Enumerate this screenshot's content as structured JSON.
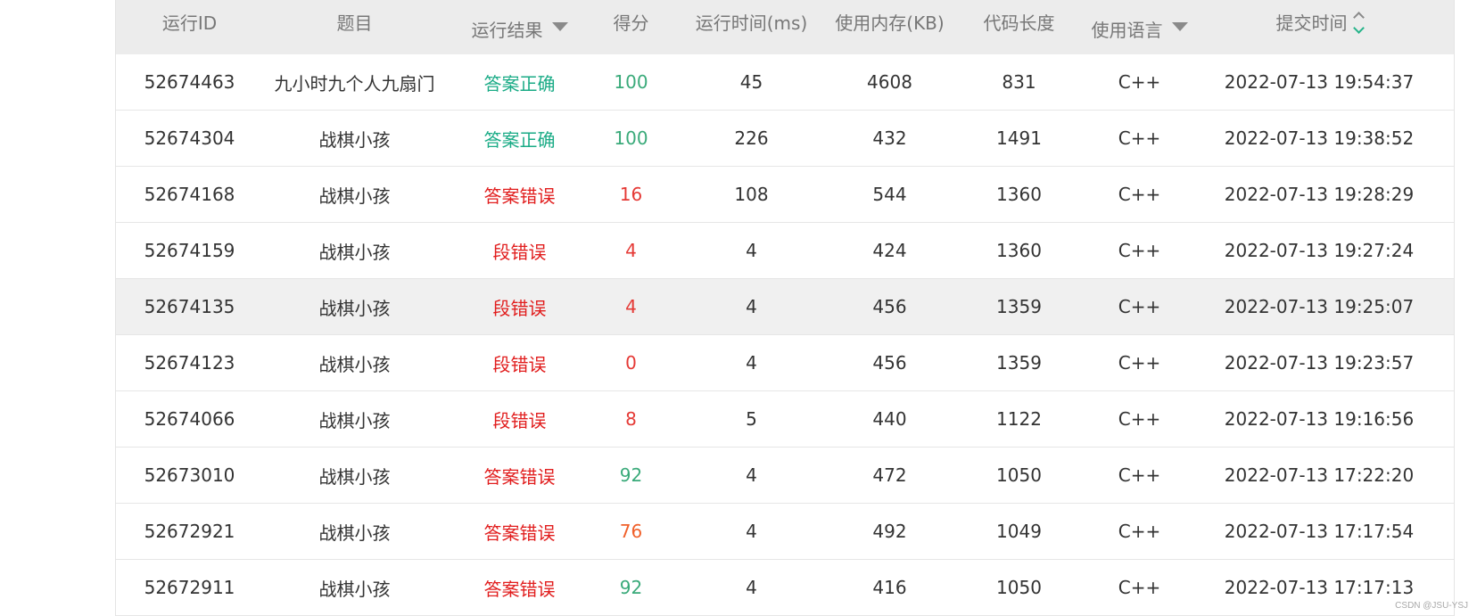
{
  "columns": {
    "run_id": "运行ID",
    "title": "题目",
    "result": "运行结果",
    "score": "得分",
    "time": "运行时间(ms)",
    "memory": "使用内存(KB)",
    "code_length": "代码长度",
    "language": "使用语言",
    "submit_time": "提交时间"
  },
  "colors": {
    "accepted": "#1aab86",
    "error": "#e11d1d",
    "score_green": "#3aaa7a",
    "score_red": "#e53935",
    "score_orange": "#f0602a"
  },
  "rows": [
    {
      "run_id": "52674463",
      "title": "九小时九个人九扇门",
      "result": "答案正确",
      "score": "100",
      "time": "45",
      "memory": "4608",
      "code_length": "831",
      "language": "C++",
      "submit_time": "2022-07-13 19:54:37"
    },
    {
      "run_id": "52674304",
      "title": "战棋小孩",
      "result": "答案正确",
      "score": "100",
      "time": "226",
      "memory": "432",
      "code_length": "1491",
      "language": "C++",
      "submit_time": "2022-07-13 19:38:52"
    },
    {
      "run_id": "52674168",
      "title": "战棋小孩",
      "result": "答案错误",
      "score": "16",
      "time": "108",
      "memory": "544",
      "code_length": "1360",
      "language": "C++",
      "submit_time": "2022-07-13 19:28:29"
    },
    {
      "run_id": "52674159",
      "title": "战棋小孩",
      "result": "段错误",
      "score": "4",
      "time": "4",
      "memory": "424",
      "code_length": "1360",
      "language": "C++",
      "submit_time": "2022-07-13 19:27:24"
    },
    {
      "run_id": "52674135",
      "title": "战棋小孩",
      "result": "段错误",
      "score": "4",
      "time": "4",
      "memory": "456",
      "code_length": "1359",
      "language": "C++",
      "submit_time": "2022-07-13 19:25:07"
    },
    {
      "run_id": "52674123",
      "title": "战棋小孩",
      "result": "段错误",
      "score": "0",
      "time": "4",
      "memory": "456",
      "code_length": "1359",
      "language": "C++",
      "submit_time": "2022-07-13 19:23:57"
    },
    {
      "run_id": "52674066",
      "title": "战棋小孩",
      "result": "段错误",
      "score": "8",
      "time": "5",
      "memory": "440",
      "code_length": "1122",
      "language": "C++",
      "submit_time": "2022-07-13 19:16:56"
    },
    {
      "run_id": "52673010",
      "title": "战棋小孩",
      "result": "答案错误",
      "score": "92",
      "time": "4",
      "memory": "472",
      "code_length": "1050",
      "language": "C++",
      "submit_time": "2022-07-13 17:22:20"
    },
    {
      "run_id": "52672921",
      "title": "战棋小孩",
      "result": "答案错误",
      "score": "76",
      "time": "4",
      "memory": "492",
      "code_length": "1049",
      "language": "C++",
      "submit_time": "2022-07-13 17:17:54"
    },
    {
      "run_id": "52672911",
      "title": "战棋小孩",
      "result": "答案错误",
      "score": "92",
      "time": "4",
      "memory": "416",
      "code_length": "1050",
      "language": "C++",
      "submit_time": "2022-07-13 17:17:13"
    }
  ],
  "watermark": "CSDN @JSU-YSJ"
}
